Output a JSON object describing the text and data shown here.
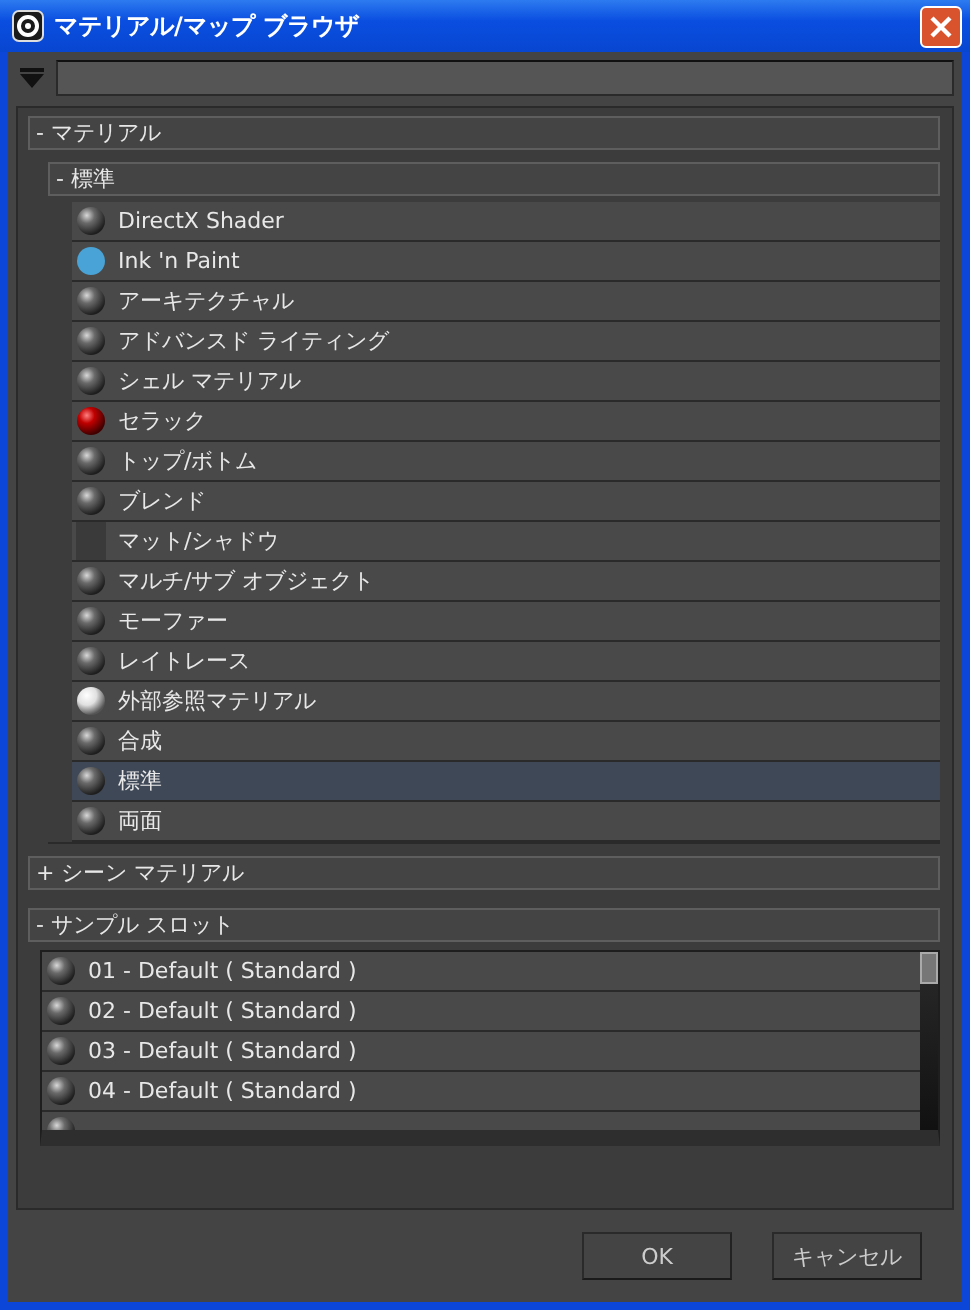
{
  "window": {
    "title": "マテリアル/マップ ブラウザ"
  },
  "groups": [
    {
      "toggle": "-",
      "label": "マテリアル",
      "subgroups": [
        {
          "toggle": "-",
          "label": "標準",
          "items": [
            {
              "label": "DirectX Shader",
              "kind": "sphere",
              "selected": false
            },
            {
              "label": "Ink 'n Paint",
              "kind": "flat",
              "selected": false
            },
            {
              "label": "アーキテクチャル",
              "kind": "sphere",
              "selected": false
            },
            {
              "label": "アドバンスド ライティング",
              "kind": "sphere",
              "selected": false
            },
            {
              "label": "シェル マテリアル",
              "kind": "sphere",
              "selected": false
            },
            {
              "label": "セラック",
              "kind": "red",
              "selected": false
            },
            {
              "label": "トップ/ボトム",
              "kind": "sphere",
              "selected": false
            },
            {
              "label": "ブレンド",
              "kind": "sphere",
              "selected": false
            },
            {
              "label": "マット/シャドウ",
              "kind": "matte",
              "selected": false
            },
            {
              "label": "マルチ/サブ オブジェクト",
              "kind": "sphere",
              "selected": false
            },
            {
              "label": "モーファー",
              "kind": "sphere",
              "selected": false
            },
            {
              "label": "レイトレース",
              "kind": "sphere",
              "selected": false
            },
            {
              "label": "外部参照マテリアル",
              "kind": "white",
              "selected": false
            },
            {
              "label": "合成",
              "kind": "sphere",
              "selected": false
            },
            {
              "label": "標準",
              "kind": "sphere",
              "selected": true
            },
            {
              "label": "両面",
              "kind": "sphere",
              "selected": false
            }
          ]
        }
      ]
    },
    {
      "toggle": "+",
      "label": "シーン マテリアル"
    },
    {
      "toggle": "-",
      "label": "サンプル スロット",
      "slots": [
        {
          "label": "01 - Default ( Standard )",
          "kind": "sphere"
        },
        {
          "label": "02 - Default ( Standard )",
          "kind": "sphere"
        },
        {
          "label": "03 - Default ( Standard )",
          "kind": "sphere"
        },
        {
          "label": "04 - Default ( Standard )",
          "kind": "sphere"
        },
        {
          "kind": "sphere"
        }
      ]
    }
  ],
  "buttons": [
    "OK",
    "キャンセル"
  ]
}
